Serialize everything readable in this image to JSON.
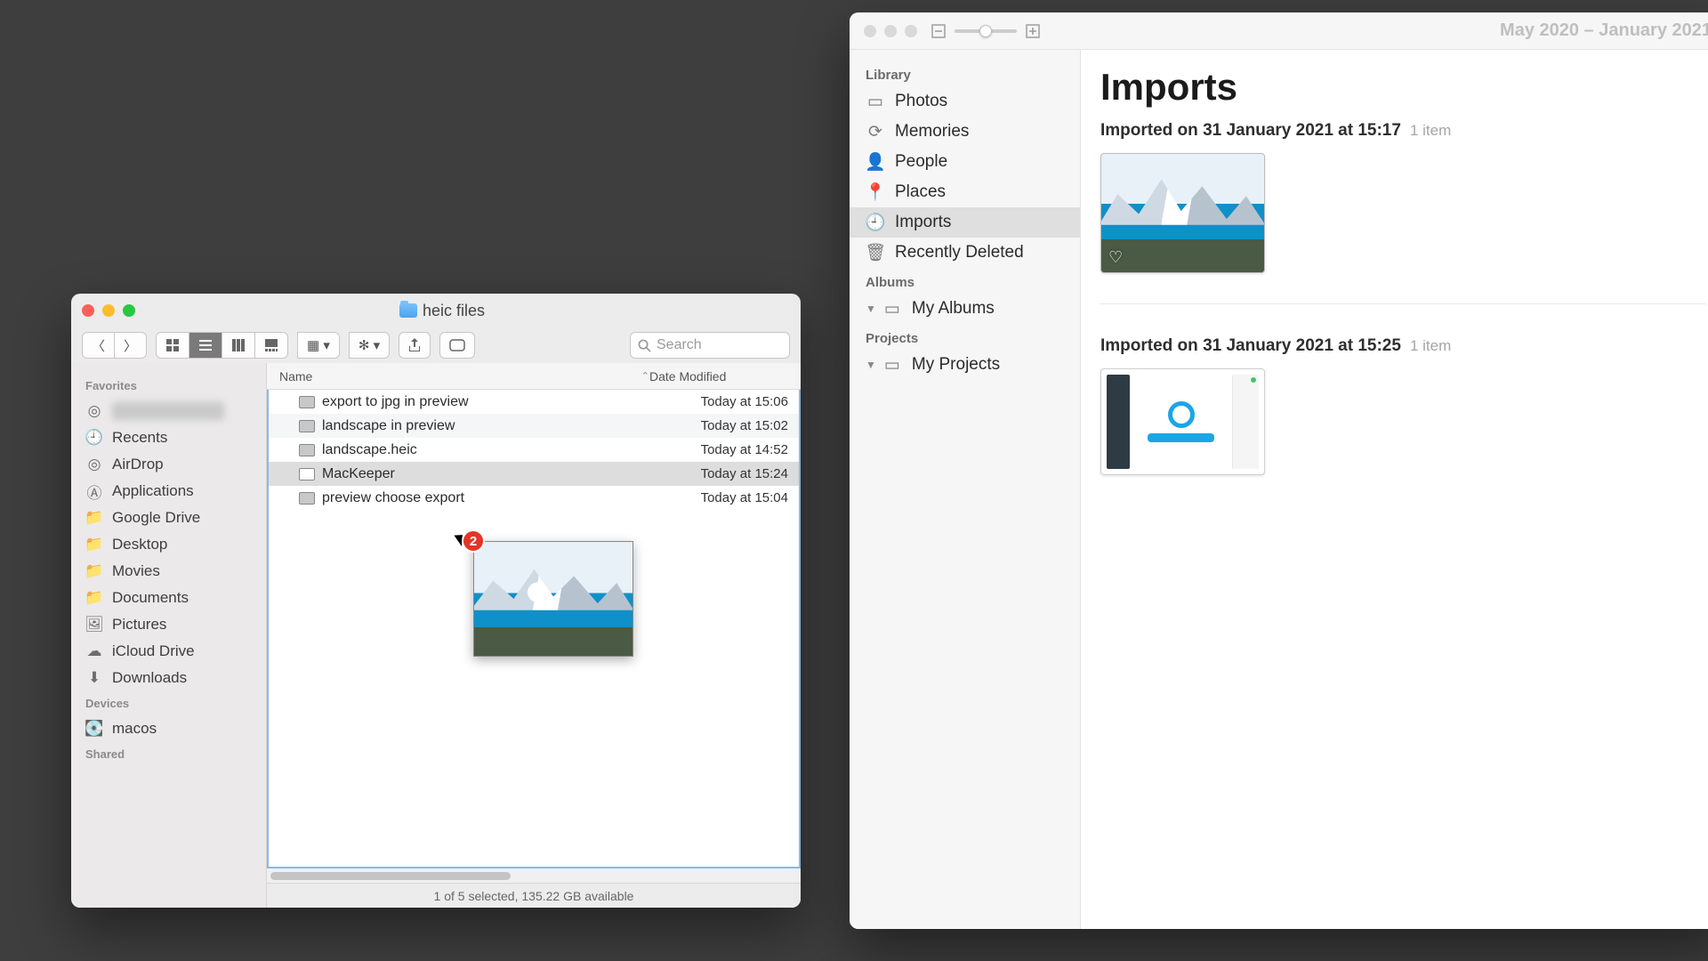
{
  "finder": {
    "window_title": "heic files",
    "toolbar": {
      "search_placeholder": "Search"
    },
    "sidebar": {
      "sections": [
        {
          "title": "Favorites",
          "items": [
            {
              "label": "redacted",
              "icon": "airdrop",
              "blurred": true
            },
            {
              "label": "Recents",
              "icon": "clock"
            },
            {
              "label": "AirDrop",
              "icon": "airdrop"
            },
            {
              "label": "Applications",
              "icon": "apps"
            },
            {
              "label": "Google Drive",
              "icon": "folder"
            },
            {
              "label": "Desktop",
              "icon": "folder"
            },
            {
              "label": "Movies",
              "icon": "folder"
            },
            {
              "label": "Documents",
              "icon": "folder"
            },
            {
              "label": "Pictures",
              "icon": "pictures"
            },
            {
              "label": "iCloud Drive",
              "icon": "cloud"
            },
            {
              "label": "Downloads",
              "icon": "download"
            }
          ]
        },
        {
          "title": "Devices",
          "items": [
            {
              "label": "macos",
              "icon": "disk"
            }
          ]
        },
        {
          "title": "Shared",
          "items": []
        }
      ]
    },
    "columns": {
      "name": "Name",
      "date": "Date Modified"
    },
    "files": [
      {
        "name": "export to jpg in preview",
        "date": "Today at 15:06",
        "selected": false
      },
      {
        "name": "landscape in preview",
        "date": "Today at 15:02",
        "selected": false
      },
      {
        "name": "landscape.heic",
        "date": "Today at 14:52",
        "selected": false
      },
      {
        "name": "MacKeeper",
        "date": "Today at 15:24",
        "selected": true,
        "app": true
      },
      {
        "name": "preview choose export",
        "date": "Today at 15:04",
        "selected": false
      }
    ],
    "drag_badge": "2",
    "status": "1 of 5 selected, 135.22 GB available"
  },
  "photos": {
    "date_range": "May 2020 – January 2021",
    "sidebar": {
      "library_title": "Library",
      "library": [
        {
          "label": "Photos",
          "icon": "photos"
        },
        {
          "label": "Memories",
          "icon": "memories"
        },
        {
          "label": "People",
          "icon": "people"
        },
        {
          "label": "Places",
          "icon": "places"
        },
        {
          "label": "Imports",
          "icon": "imports",
          "selected": true
        },
        {
          "label": "Recently Deleted",
          "icon": "trash"
        }
      ],
      "albums_title": "Albums",
      "albums": [
        {
          "label": "My Albums",
          "disclosure": true
        }
      ],
      "projects_title": "Projects",
      "projects": [
        {
          "label": "My Projects",
          "disclosure": true
        }
      ]
    },
    "main": {
      "heading": "Imports",
      "groups": [
        {
          "line_prefix": "Imported on ",
          "line_bold": "31 January 2021 at 15:17",
          "count": "1 item",
          "thumb": "landscape"
        },
        {
          "line_prefix": "Imported on ",
          "line_bold": "31 January 2021 at 15:25",
          "count": "1 item",
          "thumb": "app"
        }
      ]
    }
  }
}
